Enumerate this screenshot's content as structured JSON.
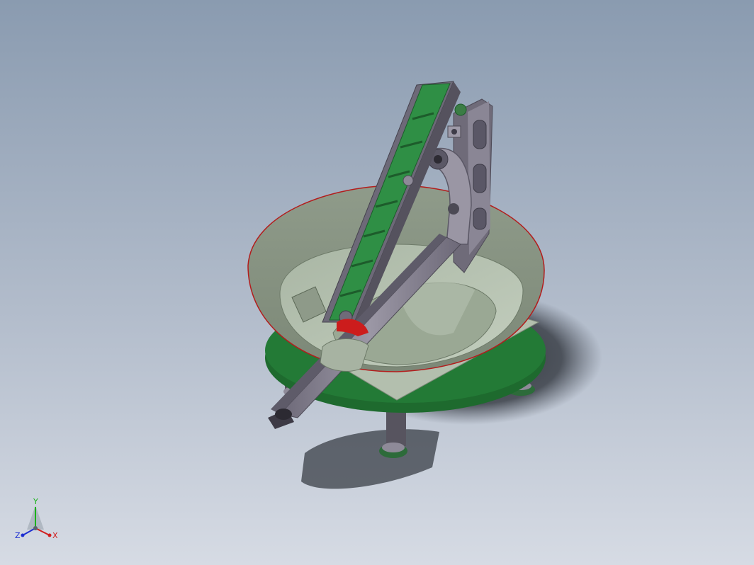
{
  "scene": {
    "background_top": "#8a9bb0",
    "background_bottom": "#d6dbe4",
    "colors": {
      "bowl": "#9aa894",
      "bowl_inner": "#b6c3b0",
      "conveyor_belt": "#2f8f45",
      "base_disc": "#237a36",
      "frame_metal": "#7e7a88",
      "highlight_red": "#cc1c1c"
    }
  },
  "triad": {
    "x_label": "X",
    "y_label": "Y",
    "z_label": "Z",
    "x_color": "#d11d1d",
    "y_color": "#1bb21b",
    "z_color": "#1d2fd1"
  }
}
